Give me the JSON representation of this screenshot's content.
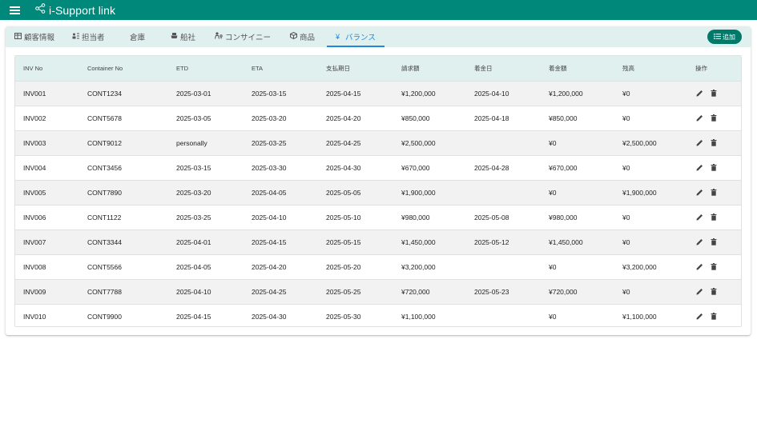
{
  "app": {
    "title": "i-Support link"
  },
  "tabs": [
    {
      "id": "customers",
      "label": "顧客情報",
      "icon": "table-icon"
    },
    {
      "id": "staff",
      "label": "担当者",
      "icon": "staff-sort-icon"
    },
    {
      "id": "warehouse",
      "label": "倉庫",
      "icon": ""
    },
    {
      "id": "shipping",
      "label": "船社",
      "icon": "ship-icon"
    },
    {
      "id": "consignee",
      "label": "コンサイニー",
      "icon": "person-key-icon"
    },
    {
      "id": "products",
      "label": "商品",
      "icon": "box-icon"
    },
    {
      "id": "balance",
      "label": "バランス",
      "icon": "yen-icon",
      "active": true
    }
  ],
  "toolbar": {
    "add_label": "追加"
  },
  "table": {
    "columns": [
      "INV No",
      "Container No",
      "ETD",
      "ETA",
      "支払期日",
      "請求額",
      "着金日",
      "着金額",
      "残高",
      "操作"
    ],
    "rows": [
      [
        "INV001",
        "CONT1234",
        "2025-03-01",
        "2025-03-15",
        "2025-04-15",
        "¥1,200,000",
        "2025-04-10",
        "¥1,200,000",
        "¥0"
      ],
      [
        "INV002",
        "CONT5678",
        "2025-03-05",
        "2025-03-20",
        "2025-04-20",
        "¥850,000",
        "2025-04-18",
        "¥850,000",
        "¥0"
      ],
      [
        "INV003",
        "CONT9012",
        "personally",
        "2025-03-25",
        "2025-04-25",
        "¥2,500,000",
        "",
        "¥0",
        "¥2,500,000"
      ],
      [
        "INV004",
        "CONT3456",
        "2025-03-15",
        "2025-03-30",
        "2025-04-30",
        "¥670,000",
        "2025-04-28",
        "¥670,000",
        "¥0"
      ],
      [
        "INV005",
        "CONT7890",
        "2025-03-20",
        "2025-04-05",
        "2025-05-05",
        "¥1,900,000",
        "",
        "¥0",
        "¥1,900,000"
      ],
      [
        "INV006",
        "CONT1122",
        "2025-03-25",
        "2025-04-10",
        "2025-05-10",
        "¥980,000",
        "2025-05-08",
        "¥980,000",
        "¥0"
      ],
      [
        "INV007",
        "CONT3344",
        "2025-04-01",
        "2025-04-15",
        "2025-05-15",
        "¥1,450,000",
        "2025-05-12",
        "¥1,450,000",
        "¥0"
      ],
      [
        "INV008",
        "CONT5566",
        "2025-04-05",
        "2025-04-20",
        "2025-05-20",
        "¥3,200,000",
        "",
        "¥0",
        "¥3,200,000"
      ],
      [
        "INV009",
        "CONT7788",
        "2025-04-10",
        "2025-04-25",
        "2025-05-25",
        "¥720,000",
        "2025-05-23",
        "¥720,000",
        "¥0"
      ],
      [
        "INV010",
        "CONT9900",
        "2025-04-15",
        "2025-04-30",
        "2025-05-30",
        "¥1,100,000",
        "",
        "¥0",
        "¥1,100,000"
      ]
    ],
    "row_actions": [
      "edit-icon",
      "delete-icon"
    ]
  },
  "colors": {
    "appbar": "#00897b",
    "accent": "#1e88e5",
    "add_button": "#00796b",
    "header_bg": "#e0f0ef"
  }
}
